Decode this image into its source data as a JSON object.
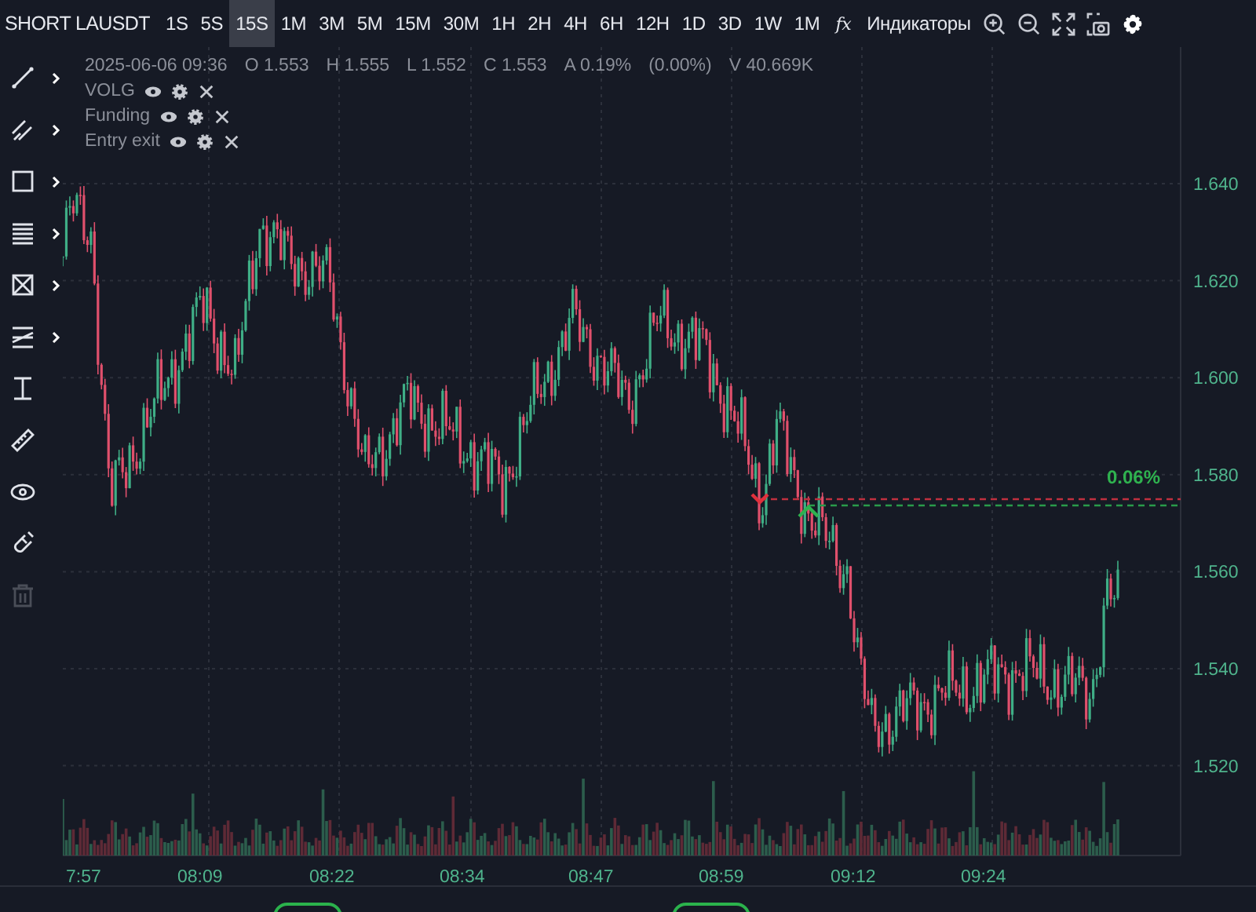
{
  "header": {
    "symbol": "SHORT LAUSDT",
    "intervals": [
      {
        "label": "1S",
        "selected": false
      },
      {
        "label": "5S",
        "selected": false
      },
      {
        "label": "15S",
        "selected": true
      },
      {
        "label": "1M",
        "selected": false
      },
      {
        "label": "3M",
        "selected": false
      },
      {
        "label": "5M",
        "selected": false
      },
      {
        "label": "15M",
        "selected": false
      },
      {
        "label": "30M",
        "selected": false
      },
      {
        "label": "1H",
        "selected": false
      },
      {
        "label": "2H",
        "selected": false
      },
      {
        "label": "4H",
        "selected": false
      },
      {
        "label": "6H",
        "selected": false
      },
      {
        "label": "12H",
        "selected": false
      },
      {
        "label": "1D",
        "selected": false
      },
      {
        "label": "3D",
        "selected": false
      },
      {
        "label": "1W",
        "selected": false
      },
      {
        "label": "1M",
        "selected": false
      }
    ],
    "fx": "fx",
    "indicators_button": "Индикаторы",
    "actions": [
      {
        "kind": "zoom-in"
      },
      {
        "kind": "zoom-out"
      },
      {
        "kind": "fullscreen"
      },
      {
        "kind": "screenshot"
      },
      {
        "kind": "settings"
      }
    ]
  },
  "tools": [
    {
      "kind": "line",
      "submenu": true,
      "disabled": false
    },
    {
      "kind": "parallel",
      "submenu": true,
      "disabled": false
    },
    {
      "kind": "rect",
      "submenu": true,
      "disabled": false
    },
    {
      "kind": "fib",
      "submenu": true,
      "disabled": false
    },
    {
      "kind": "pattern",
      "submenu": true,
      "disabled": false
    },
    {
      "kind": "channel",
      "submenu": true,
      "disabled": false
    },
    {
      "kind": "measure",
      "submenu": false,
      "disabled": false
    },
    {
      "kind": "ruler",
      "submenu": false,
      "disabled": false
    },
    {
      "kind": "eye",
      "submenu": false,
      "disabled": false
    },
    {
      "kind": "magnet",
      "submenu": false,
      "disabled": false
    },
    {
      "kind": "trash",
      "submenu": false,
      "disabled": true
    }
  ],
  "legend": {
    "datetime": "2025-06-06 09:36",
    "values": [
      "O 1.553",
      "H 1.555",
      "L 1.552",
      "C 1.553",
      "A 0.19%",
      "(0.00%)",
      "V 40.669K"
    ]
  },
  "indicators": [
    {
      "name": "VOLG"
    },
    {
      "name": "Funding"
    },
    {
      "name": "Entry exit"
    }
  ],
  "price_axis": [
    "1.640",
    "1.620",
    "1.600",
    "1.580",
    "1.560",
    "1.540",
    "1.520"
  ],
  "time_axis": [
    "7:57",
    "08:09",
    "08:22",
    "08:34",
    "08:47",
    "08:59",
    "09:12",
    "09:24"
  ],
  "position": {
    "pnl": "0.06%"
  }
}
